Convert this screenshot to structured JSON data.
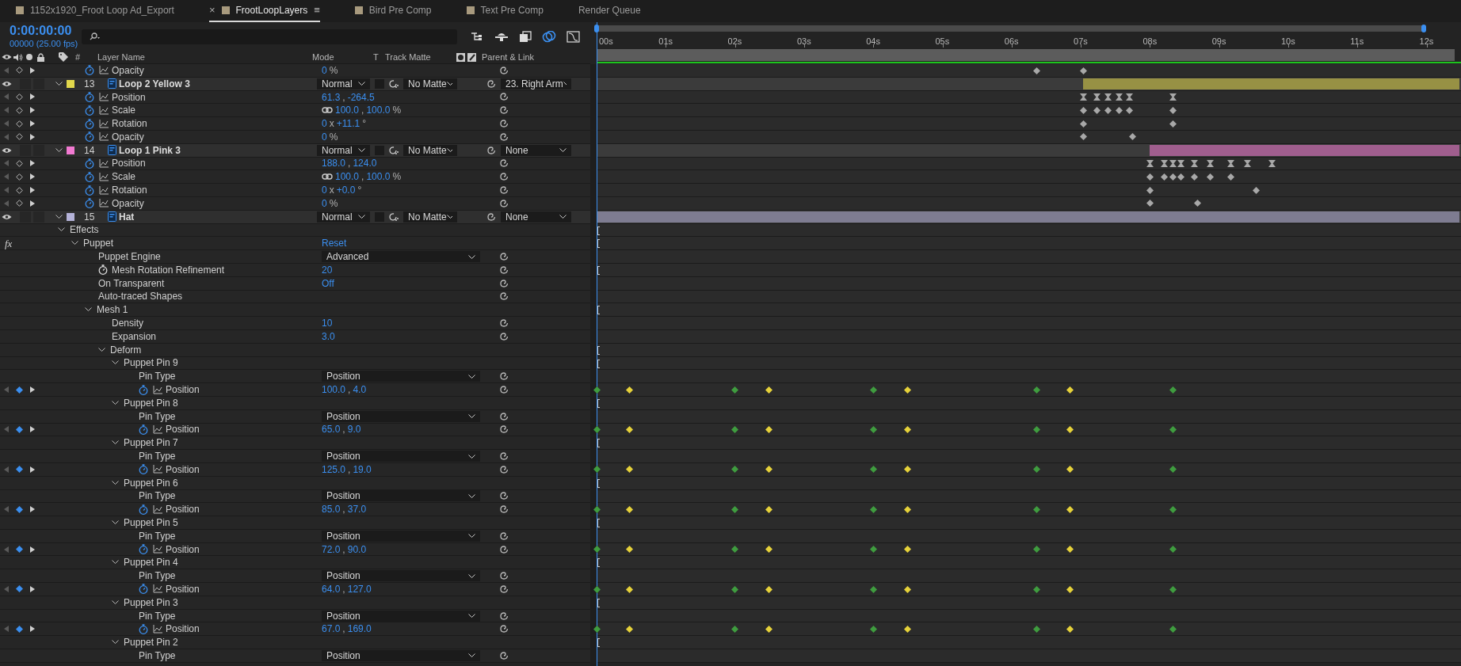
{
  "tabs": [
    {
      "label": "1152x1920_Froot Loop Ad_Export",
      "kind": "comp",
      "selected": false
    },
    {
      "label": "FrootLoopLayers",
      "kind": "comp",
      "selected": true,
      "close": "×",
      "menu": "≡"
    },
    {
      "label": "Bird Pre Comp",
      "kind": "comp",
      "selected": false
    },
    {
      "label": "Text Pre Comp",
      "kind": "comp",
      "selected": false
    },
    {
      "label": "Render Queue",
      "kind": "queue",
      "selected": false
    }
  ],
  "timecode": "0:00:00:00",
  "frame_readout": "00000 (25.00 fps)",
  "columns": {
    "number": "#",
    "layer_name": "Layer Name",
    "mode": "Mode",
    "t": "T",
    "track_matte": "Track Matte",
    "parent": "Parent & Link"
  },
  "ruler": [
    "00s",
    "01s",
    "02s",
    "03s",
    "04s",
    "05s",
    "06s",
    "07s",
    "08s",
    "09s",
    "10s",
    "11s",
    "12s"
  ],
  "rows": [
    {
      "kind": "property",
      "name": "Opacity",
      "animated": true,
      "at_keyframe": false,
      "value": [
        "0",
        "%"
      ],
      "keyframes": [
        {
          "level": 0.5096,
          "kind": "linear",
          "color": "#a8a8a8"
        },
        {
          "level": 0.5632,
          "kind": "linear",
          "color": "#a8a8a8"
        }
      ]
    },
    {
      "kind": "layer",
      "number": "13",
      "name": "Loop 2 Yellow 3",
      "color": "#e2d84c",
      "level": 0.4368,
      "solo": false,
      "locked": false,
      "preserve_transparency": false,
      "mode": "Normal",
      "track_matte": "No Matte",
      "parent": "23. Right Arm",
      "expanded": true,
      "children": [
        {
          "kind": "property",
          "name": "Position",
          "animated": true,
          "at_keyframe": false,
          "value": [
            "61.3",
            ",",
            "-264.5"
          ],
          "keyframes": [
            {
              "level": 0.5632,
              "kind": "hold",
              "color": "#a8a8a8"
            },
            {
              "level": 0.5792,
              "kind": "hold",
              "color": "#a8a8a8"
            },
            {
              "level": 0.592,
              "kind": "hold",
              "color": "#a8a8a8"
            },
            {
              "level": 0.6048,
              "kind": "hold",
              "color": "#a8a8a8"
            },
            {
              "level": 0.6168,
              "kind": "hold",
              "color": "#a8a8a8"
            },
            {
              "level": 0.6664,
              "kind": "hold",
              "color": "#a8a8a8"
            }
          ]
        },
        {
          "kind": "property",
          "name": "Scale",
          "animated": true,
          "at_keyframe": false,
          "constrain": true,
          "value": [
            "100.0",
            ",",
            "100.0",
            "%"
          ],
          "keyframes": [
            {
              "level": 0.5632,
              "kind": "linear",
              "color": "#a8a8a8"
            },
            {
              "level": 0.5792,
              "kind": "linear",
              "color": "#a8a8a8"
            },
            {
              "level": 0.592,
              "kind": "linear",
              "color": "#a8a8a8"
            },
            {
              "level": 0.6048,
              "kind": "linear",
              "color": "#a8a8a8"
            },
            {
              "level": 0.6168,
              "kind": "linear",
              "color": "#a8a8a8"
            },
            {
              "level": 0.6664,
              "kind": "linear",
              "color": "#a8a8a8"
            }
          ]
        },
        {
          "kind": "property",
          "name": "Rotation",
          "animated": true,
          "at_keyframe": false,
          "value": [
            "0",
            "x",
            "+11.1",
            "°"
          ],
          "keyframes": [
            {
              "level": 0.5632,
              "kind": "linear",
              "color": "#a8a8a8"
            },
            {
              "level": 0.6664,
              "kind": "linear",
              "color": "#a8a8a8"
            }
          ]
        },
        {
          "kind": "property",
          "name": "Opacity",
          "animated": true,
          "at_keyframe": false,
          "value": [
            "0",
            "%"
          ],
          "keyframes": [
            {
              "level": 0.5632,
              "kind": "linear",
              "color": "#a8a8a8"
            },
            {
              "level": 0.62,
              "kind": "linear",
              "color": "#a8a8a8"
            }
          ]
        }
      ]
    },
    {
      "kind": "layer",
      "number": "14",
      "name": "Loop 1 Pink 3",
      "color": "#f27ad2",
      "level": 0.36,
      "solo": false,
      "locked": false,
      "preserve_transparency": false,
      "mode": "Normal",
      "track_matte": "No Matte",
      "parent": "None",
      "expanded": true,
      "children": [
        {
          "kind": "property",
          "name": "Position",
          "animated": true,
          "at_keyframe": false,
          "value": [
            "188.0",
            ",",
            "124.0"
          ],
          "keyframes": [
            {
              "level": 0.64,
              "kind": "hold",
              "color": "#a8a8a8"
            },
            {
              "level": 0.6568,
              "kind": "hold",
              "color": "#a8a8a8"
            },
            {
              "level": 0.6664,
              "kind": "hold",
              "color": "#a8a8a8"
            },
            {
              "level": 0.676,
              "kind": "hold",
              "color": "#a8a8a8"
            },
            {
              "level": 0.692,
              "kind": "hold",
              "color": "#a8a8a8"
            },
            {
              "level": 0.7096,
              "kind": "hold",
              "color": "#a8a8a8"
            },
            {
              "level": 0.7336,
              "kind": "hold",
              "color": "#a8a8a8"
            },
            {
              "level": 0.7528,
              "kind": "hold",
              "color": "#a8a8a8"
            },
            {
              "level": 0.7816,
              "kind": "hold",
              "color": "#a8a8a8"
            }
          ]
        },
        {
          "kind": "property",
          "name": "Scale",
          "animated": true,
          "at_keyframe": false,
          "constrain": true,
          "value": [
            "100.0",
            ",",
            "100.0",
            "%"
          ],
          "keyframes": [
            {
              "level": 0.64,
              "kind": "linear",
              "color": "#a8a8a8"
            },
            {
              "level": 0.6568,
              "kind": "linear",
              "color": "#a8a8a8"
            },
            {
              "level": 0.6664,
              "kind": "linear",
              "color": "#a8a8a8"
            },
            {
              "level": 0.676,
              "kind": "linear",
              "color": "#a8a8a8"
            },
            {
              "level": 0.692,
              "kind": "linear",
              "color": "#a8a8a8"
            },
            {
              "level": 0.7096,
              "kind": "linear",
              "color": "#a8a8a8"
            },
            {
              "level": 0.7336,
              "kind": "linear",
              "color": "#a8a8a8"
            }
          ]
        },
        {
          "kind": "property",
          "name": "Rotation",
          "animated": true,
          "at_keyframe": false,
          "value": [
            "0",
            "x",
            "+0.0",
            "°"
          ],
          "keyframes": [
            {
              "level": 0.64,
              "kind": "linear",
              "color": "#a8a8a8"
            },
            {
              "level": 0.7632,
              "kind": "linear",
              "color": "#a8a8a8"
            }
          ]
        },
        {
          "kind": "property",
          "name": "Opacity",
          "animated": true,
          "at_keyframe": false,
          "value": [
            "0",
            "%"
          ],
          "keyframes": [
            {
              "level": 0.64,
              "kind": "linear",
              "color": "#a8a8a8"
            },
            {
              "level": 0.6952,
              "kind": "linear",
              "color": "#a8a8a8"
            }
          ]
        }
      ]
    },
    {
      "kind": "layer",
      "number": "15",
      "name": "Hat",
      "color": "#b4b2d8",
      "level": 1,
      "solo": false,
      "locked": false,
      "preserve_transparency": false,
      "mode": "Normal",
      "track_matte": "No Matte",
      "parent": "None",
      "expanded": true,
      "children": [
        {
          "kind": "group",
          "name": "Effects",
          "expanded": true,
          "marker": true,
          "children": [
            {
              "kind": "effect",
              "name": "Puppet",
              "fx": "fx",
              "reset": "Reset",
              "expanded": true,
              "marker": true,
              "children": [
                {
                  "kind": "dropdown",
                  "name": "Puppet Engine",
                  "value": "Advanced"
                },
                {
                  "kind": "value",
                  "name": "Mesh Rotation Refinement",
                  "stopwatch": true,
                  "marker": true,
                  "value": "20"
                },
                {
                  "kind": "value",
                  "name": "On Transparent",
                  "value": "Off"
                },
                {
                  "kind": "value",
                  "name": "Auto-traced Shapes"
                },
                {
                  "kind": "group",
                  "name": "Mesh 1",
                  "expanded": true,
                  "marker": true,
                  "children": [
                    {
                      "kind": "value",
                      "name": "Density",
                      "value": "10"
                    },
                    {
                      "kind": "value",
                      "name": "Expansion",
                      "value": "3.0"
                    },
                    {
                      "kind": "group",
                      "name": "Deform",
                      "expanded": true,
                      "marker": true,
                      "children": [
                        {
                          "kind": "group",
                          "name": "Puppet Pin 9",
                          "expanded": true,
                          "marker": true,
                          "children": [
                            {
                              "kind": "dropdown",
                              "name": "Pin Type",
                              "value": "Position"
                            },
                            {
                              "kind": "property",
                              "name": "Position",
                              "animated": true,
                              "at_keyframe": true,
                              "value": [
                                "100.0",
                                ",",
                                "4.0"
                              ],
                              "keyframes": [
                                {
                                  "level": 0,
                                  "kind": "linear",
                                  "color": "#3f9c3f"
                                },
                                {
                                  "level": 0.0376,
                                  "kind": "linear",
                                  "color": "#e6d23a"
                                },
                                {
                                  "level": 0.16,
                                  "kind": "linear",
                                  "color": "#3f9c3f"
                                },
                                {
                                  "level": 0.1992,
                                  "kind": "linear",
                                  "color": "#e6d23a"
                                },
                                {
                                  "level": 0.32,
                                  "kind": "linear",
                                  "color": "#3f9c3f"
                                },
                                {
                                  "level": 0.36,
                                  "kind": "linear",
                                  "color": "#e6d23a"
                                },
                                {
                                  "level": 0.5096,
                                  "kind": "linear",
                                  "color": "#3f9c3f"
                                },
                                {
                                  "level": 0.548,
                                  "kind": "linear",
                                  "color": "#e6d23a"
                                },
                                {
                                  "level": 0.6664,
                                  "kind": "linear",
                                  "color": "#3f9c3f"
                                }
                              ]
                            }
                          ]
                        },
                        {
                          "kind": "group",
                          "name": "Puppet Pin 8",
                          "expanded": true,
                          "marker": true,
                          "children": [
                            {
                              "kind": "dropdown",
                              "name": "Pin Type",
                              "value": "Position"
                            },
                            {
                              "kind": "property",
                              "name": "Position",
                              "animated": true,
                              "at_keyframe": true,
                              "value": [
                                "65.0",
                                ",",
                                "9.0"
                              ],
                              "keyframes": [
                                {
                                  "level": 0,
                                  "kind": "linear",
                                  "color": "#3f9c3f"
                                },
                                {
                                  "level": 0.0376,
                                  "kind": "linear",
                                  "color": "#e6d23a"
                                },
                                {
                                  "level": 0.16,
                                  "kind": "linear",
                                  "color": "#3f9c3f"
                                },
                                {
                                  "level": 0.1992,
                                  "kind": "linear",
                                  "color": "#e6d23a"
                                },
                                {
                                  "level": 0.32,
                                  "kind": "linear",
                                  "color": "#3f9c3f"
                                },
                                {
                                  "level": 0.36,
                                  "kind": "linear",
                                  "color": "#e6d23a"
                                },
                                {
                                  "level": 0.5096,
                                  "kind": "linear",
                                  "color": "#3f9c3f"
                                },
                                {
                                  "level": 0.548,
                                  "kind": "linear",
                                  "color": "#e6d23a"
                                },
                                {
                                  "level": 0.6664,
                                  "kind": "linear",
                                  "color": "#3f9c3f"
                                }
                              ]
                            }
                          ]
                        },
                        {
                          "kind": "group",
                          "name": "Puppet Pin 7",
                          "expanded": true,
                          "marker": true,
                          "children": [
                            {
                              "kind": "dropdown",
                              "name": "Pin Type",
                              "value": "Position"
                            },
                            {
                              "kind": "property",
                              "name": "Position",
                              "animated": true,
                              "at_keyframe": true,
                              "value": [
                                "125.0",
                                ",",
                                "19.0"
                              ],
                              "keyframes": [
                                {
                                  "level": 0,
                                  "kind": "linear",
                                  "color": "#3f9c3f"
                                },
                                {
                                  "level": 0.0376,
                                  "kind": "linear",
                                  "color": "#e6d23a"
                                },
                                {
                                  "level": 0.16,
                                  "kind": "linear",
                                  "color": "#3f9c3f"
                                },
                                {
                                  "level": 0.1992,
                                  "kind": "linear",
                                  "color": "#e6d23a"
                                },
                                {
                                  "level": 0.32,
                                  "kind": "linear",
                                  "color": "#3f9c3f"
                                },
                                {
                                  "level": 0.36,
                                  "kind": "linear",
                                  "color": "#e6d23a"
                                },
                                {
                                  "level": 0.5096,
                                  "kind": "linear",
                                  "color": "#3f9c3f"
                                },
                                {
                                  "level": 0.548,
                                  "kind": "linear",
                                  "color": "#e6d23a"
                                },
                                {
                                  "level": 0.6664,
                                  "kind": "linear",
                                  "color": "#3f9c3f"
                                }
                              ]
                            }
                          ]
                        },
                        {
                          "kind": "group",
                          "name": "Puppet Pin 6",
                          "expanded": true,
                          "marker": true,
                          "children": [
                            {
                              "kind": "dropdown",
                              "name": "Pin Type",
                              "value": "Position"
                            },
                            {
                              "kind": "property",
                              "name": "Position",
                              "animated": true,
                              "at_keyframe": true,
                              "value": [
                                "85.0",
                                ",",
                                "37.0"
                              ],
                              "keyframes": [
                                {
                                  "level": 0,
                                  "kind": "linear",
                                  "color": "#3f9c3f"
                                },
                                {
                                  "level": 0.0376,
                                  "kind": "linear",
                                  "color": "#e6d23a"
                                },
                                {
                                  "level": 0.16,
                                  "kind": "linear",
                                  "color": "#3f9c3f"
                                },
                                {
                                  "level": 0.1992,
                                  "kind": "linear",
                                  "color": "#e6d23a"
                                },
                                {
                                  "level": 0.32,
                                  "kind": "linear",
                                  "color": "#3f9c3f"
                                },
                                {
                                  "level": 0.36,
                                  "kind": "linear",
                                  "color": "#e6d23a"
                                },
                                {
                                  "level": 0.5096,
                                  "kind": "linear",
                                  "color": "#3f9c3f"
                                },
                                {
                                  "level": 0.548,
                                  "kind": "linear",
                                  "color": "#e6d23a"
                                },
                                {
                                  "level": 0.6664,
                                  "kind": "linear",
                                  "color": "#3f9c3f"
                                }
                              ]
                            }
                          ]
                        },
                        {
                          "kind": "group",
                          "name": "Puppet Pin 5",
                          "expanded": true,
                          "marker": true,
                          "children": [
                            {
                              "kind": "dropdown",
                              "name": "Pin Type",
                              "value": "Position"
                            },
                            {
                              "kind": "property",
                              "name": "Position",
                              "animated": true,
                              "at_keyframe": true,
                              "value": [
                                "72.0",
                                ",",
                                "90.0"
                              ],
                              "keyframes": [
                                {
                                  "level": 0,
                                  "kind": "linear",
                                  "color": "#3f9c3f"
                                },
                                {
                                  "level": 0.0376,
                                  "kind": "linear",
                                  "color": "#e6d23a"
                                },
                                {
                                  "level": 0.16,
                                  "kind": "linear",
                                  "color": "#3f9c3f"
                                },
                                {
                                  "level": 0.1992,
                                  "kind": "linear",
                                  "color": "#e6d23a"
                                },
                                {
                                  "level": 0.32,
                                  "kind": "linear",
                                  "color": "#3f9c3f"
                                },
                                {
                                  "level": 0.36,
                                  "kind": "linear",
                                  "color": "#e6d23a"
                                },
                                {
                                  "level": 0.5096,
                                  "kind": "linear",
                                  "color": "#3f9c3f"
                                },
                                {
                                  "level": 0.548,
                                  "kind": "linear",
                                  "color": "#e6d23a"
                                },
                                {
                                  "level": 0.6664,
                                  "kind": "linear",
                                  "color": "#3f9c3f"
                                }
                              ]
                            }
                          ]
                        },
                        {
                          "kind": "group",
                          "name": "Puppet Pin 4",
                          "expanded": true,
                          "marker": true,
                          "children": [
                            {
                              "kind": "dropdown",
                              "name": "Pin Type",
                              "value": "Position"
                            },
                            {
                              "kind": "property",
                              "name": "Position",
                              "animated": true,
                              "at_keyframe": true,
                              "value": [
                                "64.0",
                                ",",
                                "127.0"
                              ],
                              "keyframes": [
                                {
                                  "level": 0,
                                  "kind": "linear",
                                  "color": "#3f9c3f"
                                },
                                {
                                  "level": 0.0376,
                                  "kind": "linear",
                                  "color": "#e6d23a"
                                },
                                {
                                  "level": 0.16,
                                  "kind": "linear",
                                  "color": "#3f9c3f"
                                },
                                {
                                  "level": 0.1992,
                                  "kind": "linear",
                                  "color": "#e6d23a"
                                },
                                {
                                  "level": 0.32,
                                  "kind": "linear",
                                  "color": "#3f9c3f"
                                },
                                {
                                  "level": 0.36,
                                  "kind": "linear",
                                  "color": "#e6d23a"
                                },
                                {
                                  "level": 0.5096,
                                  "kind": "linear",
                                  "color": "#3f9c3f"
                                },
                                {
                                  "level": 0.548,
                                  "kind": "linear",
                                  "color": "#e6d23a"
                                },
                                {
                                  "level": 0.6664,
                                  "kind": "linear",
                                  "color": "#3f9c3f"
                                }
                              ]
                            }
                          ]
                        },
                        {
                          "kind": "group",
                          "name": "Puppet Pin 3",
                          "expanded": true,
                          "marker": true,
                          "children": [
                            {
                              "kind": "dropdown",
                              "name": "Pin Type",
                              "value": "Position"
                            },
                            {
                              "kind": "property",
                              "name": "Position",
                              "animated": true,
                              "at_keyframe": true,
                              "value": [
                                "67.0",
                                ",",
                                "169.0"
                              ],
                              "keyframes": [
                                {
                                  "level": 0,
                                  "kind": "linear",
                                  "color": "#3f9c3f"
                                },
                                {
                                  "level": 0.0376,
                                  "kind": "linear",
                                  "color": "#e6d23a"
                                },
                                {
                                  "level": 0.16,
                                  "kind": "linear",
                                  "color": "#3f9c3f"
                                },
                                {
                                  "level": 0.1992,
                                  "kind": "linear",
                                  "color": "#e6d23a"
                                },
                                {
                                  "level": 0.32,
                                  "kind": "linear",
                                  "color": "#3f9c3f"
                                },
                                {
                                  "level": 0.36,
                                  "kind": "linear",
                                  "color": "#e6d23a"
                                },
                                {
                                  "level": 0.5096,
                                  "kind": "linear",
                                  "color": "#3f9c3f"
                                },
                                {
                                  "level": 0.548,
                                  "kind": "linear",
                                  "color": "#e6d23a"
                                },
                                {
                                  "level": 0.6664,
                                  "kind": "linear",
                                  "color": "#3f9c3f"
                                }
                              ]
                            }
                          ]
                        },
                        {
                          "kind": "group",
                          "name": "Puppet Pin 2",
                          "expanded": true,
                          "marker": true,
                          "children": [
                            {
                              "kind": "dropdown",
                              "name": "Pin Type",
                              "value": "Position"
                            }
                          ]
                        }
                      ]
                    }
                  ]
                }
              ]
            }
          ]
        }
      ]
    }
  ]
}
